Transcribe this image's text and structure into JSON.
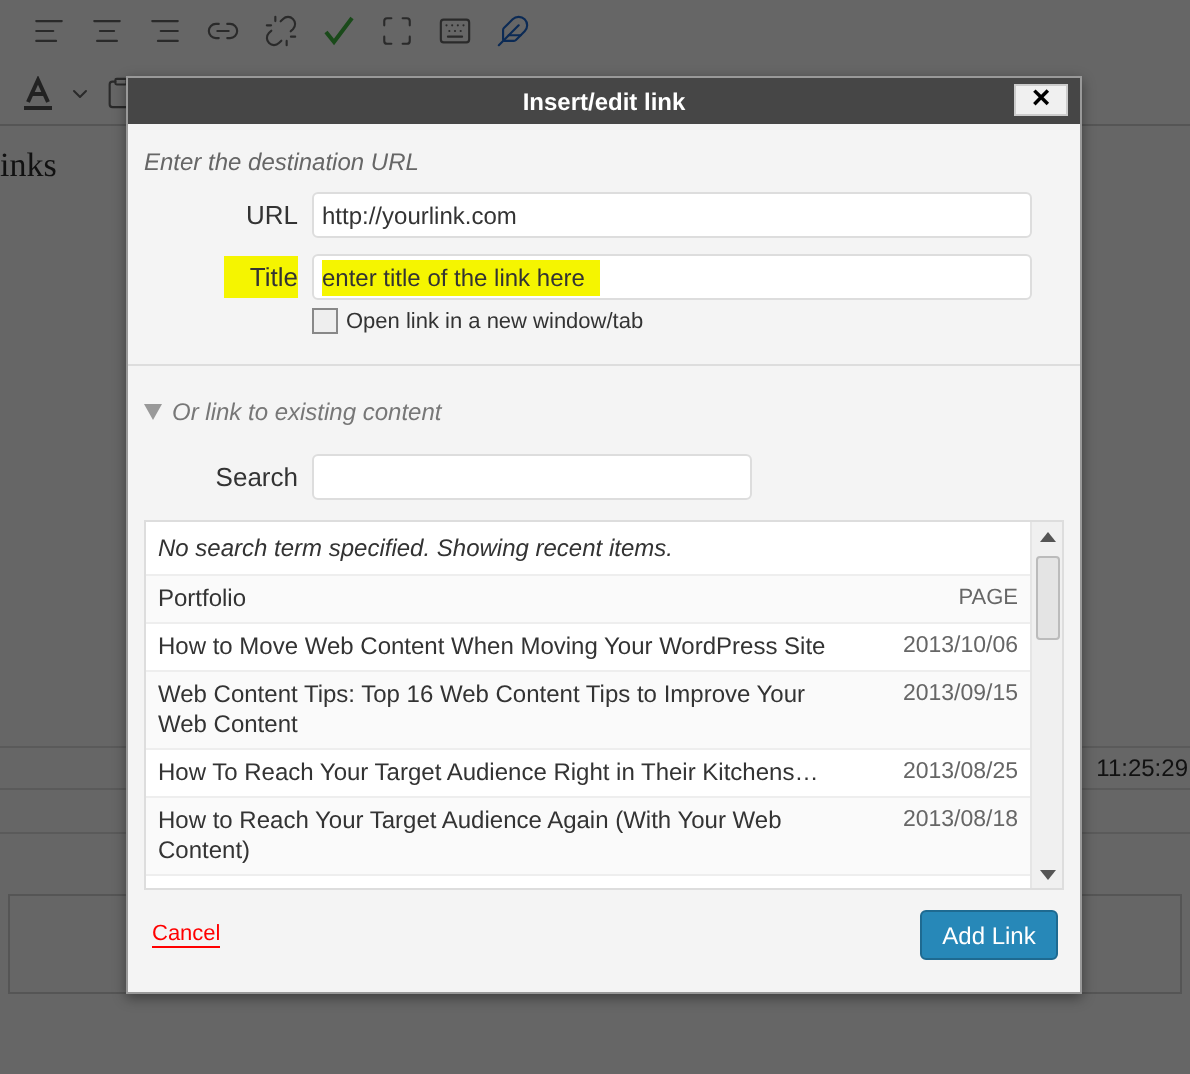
{
  "editor": {
    "body_text": "inks",
    "timestamp": "11:25:29"
  },
  "dialog": {
    "title": "Insert/edit link",
    "close_label": "×",
    "intro": "Enter the destination URL",
    "fields": [
      {
        "label": "URL",
        "value": "http://yourlink.com",
        "highlighted": false
      },
      {
        "label": "Title",
        "value": "enter title of the link here",
        "highlighted": true
      }
    ],
    "new_window": {
      "label": "Open link in a new window/tab",
      "checked": false
    },
    "existing": {
      "label": "Or link to existing content",
      "expanded": true
    },
    "search": {
      "label": "Search"
    },
    "results": {
      "message": "No search term specified. Showing recent items.",
      "items": [
        {
          "title": "Portfolio",
          "info": "PAGE",
          "kind": "page"
        },
        {
          "title": "How to Move Web Content When Moving Your WordPress Site",
          "info": "2013/10/06",
          "kind": "post"
        },
        {
          "title": "Web Content Tips: Top 16 Web Content Tips to Improve Your Web Content",
          "info": "2013/09/15",
          "kind": "post"
        },
        {
          "title": "How To Reach Your Target Audience Right in Their Kitchens…",
          "info": "2013/08/25",
          "kind": "post"
        },
        {
          "title": "How to Reach Your Target Audience Again (With Your Web Content)",
          "info": "2013/08/18",
          "kind": "post"
        }
      ]
    },
    "cancel": "Cancel",
    "submit": "Add Link"
  }
}
